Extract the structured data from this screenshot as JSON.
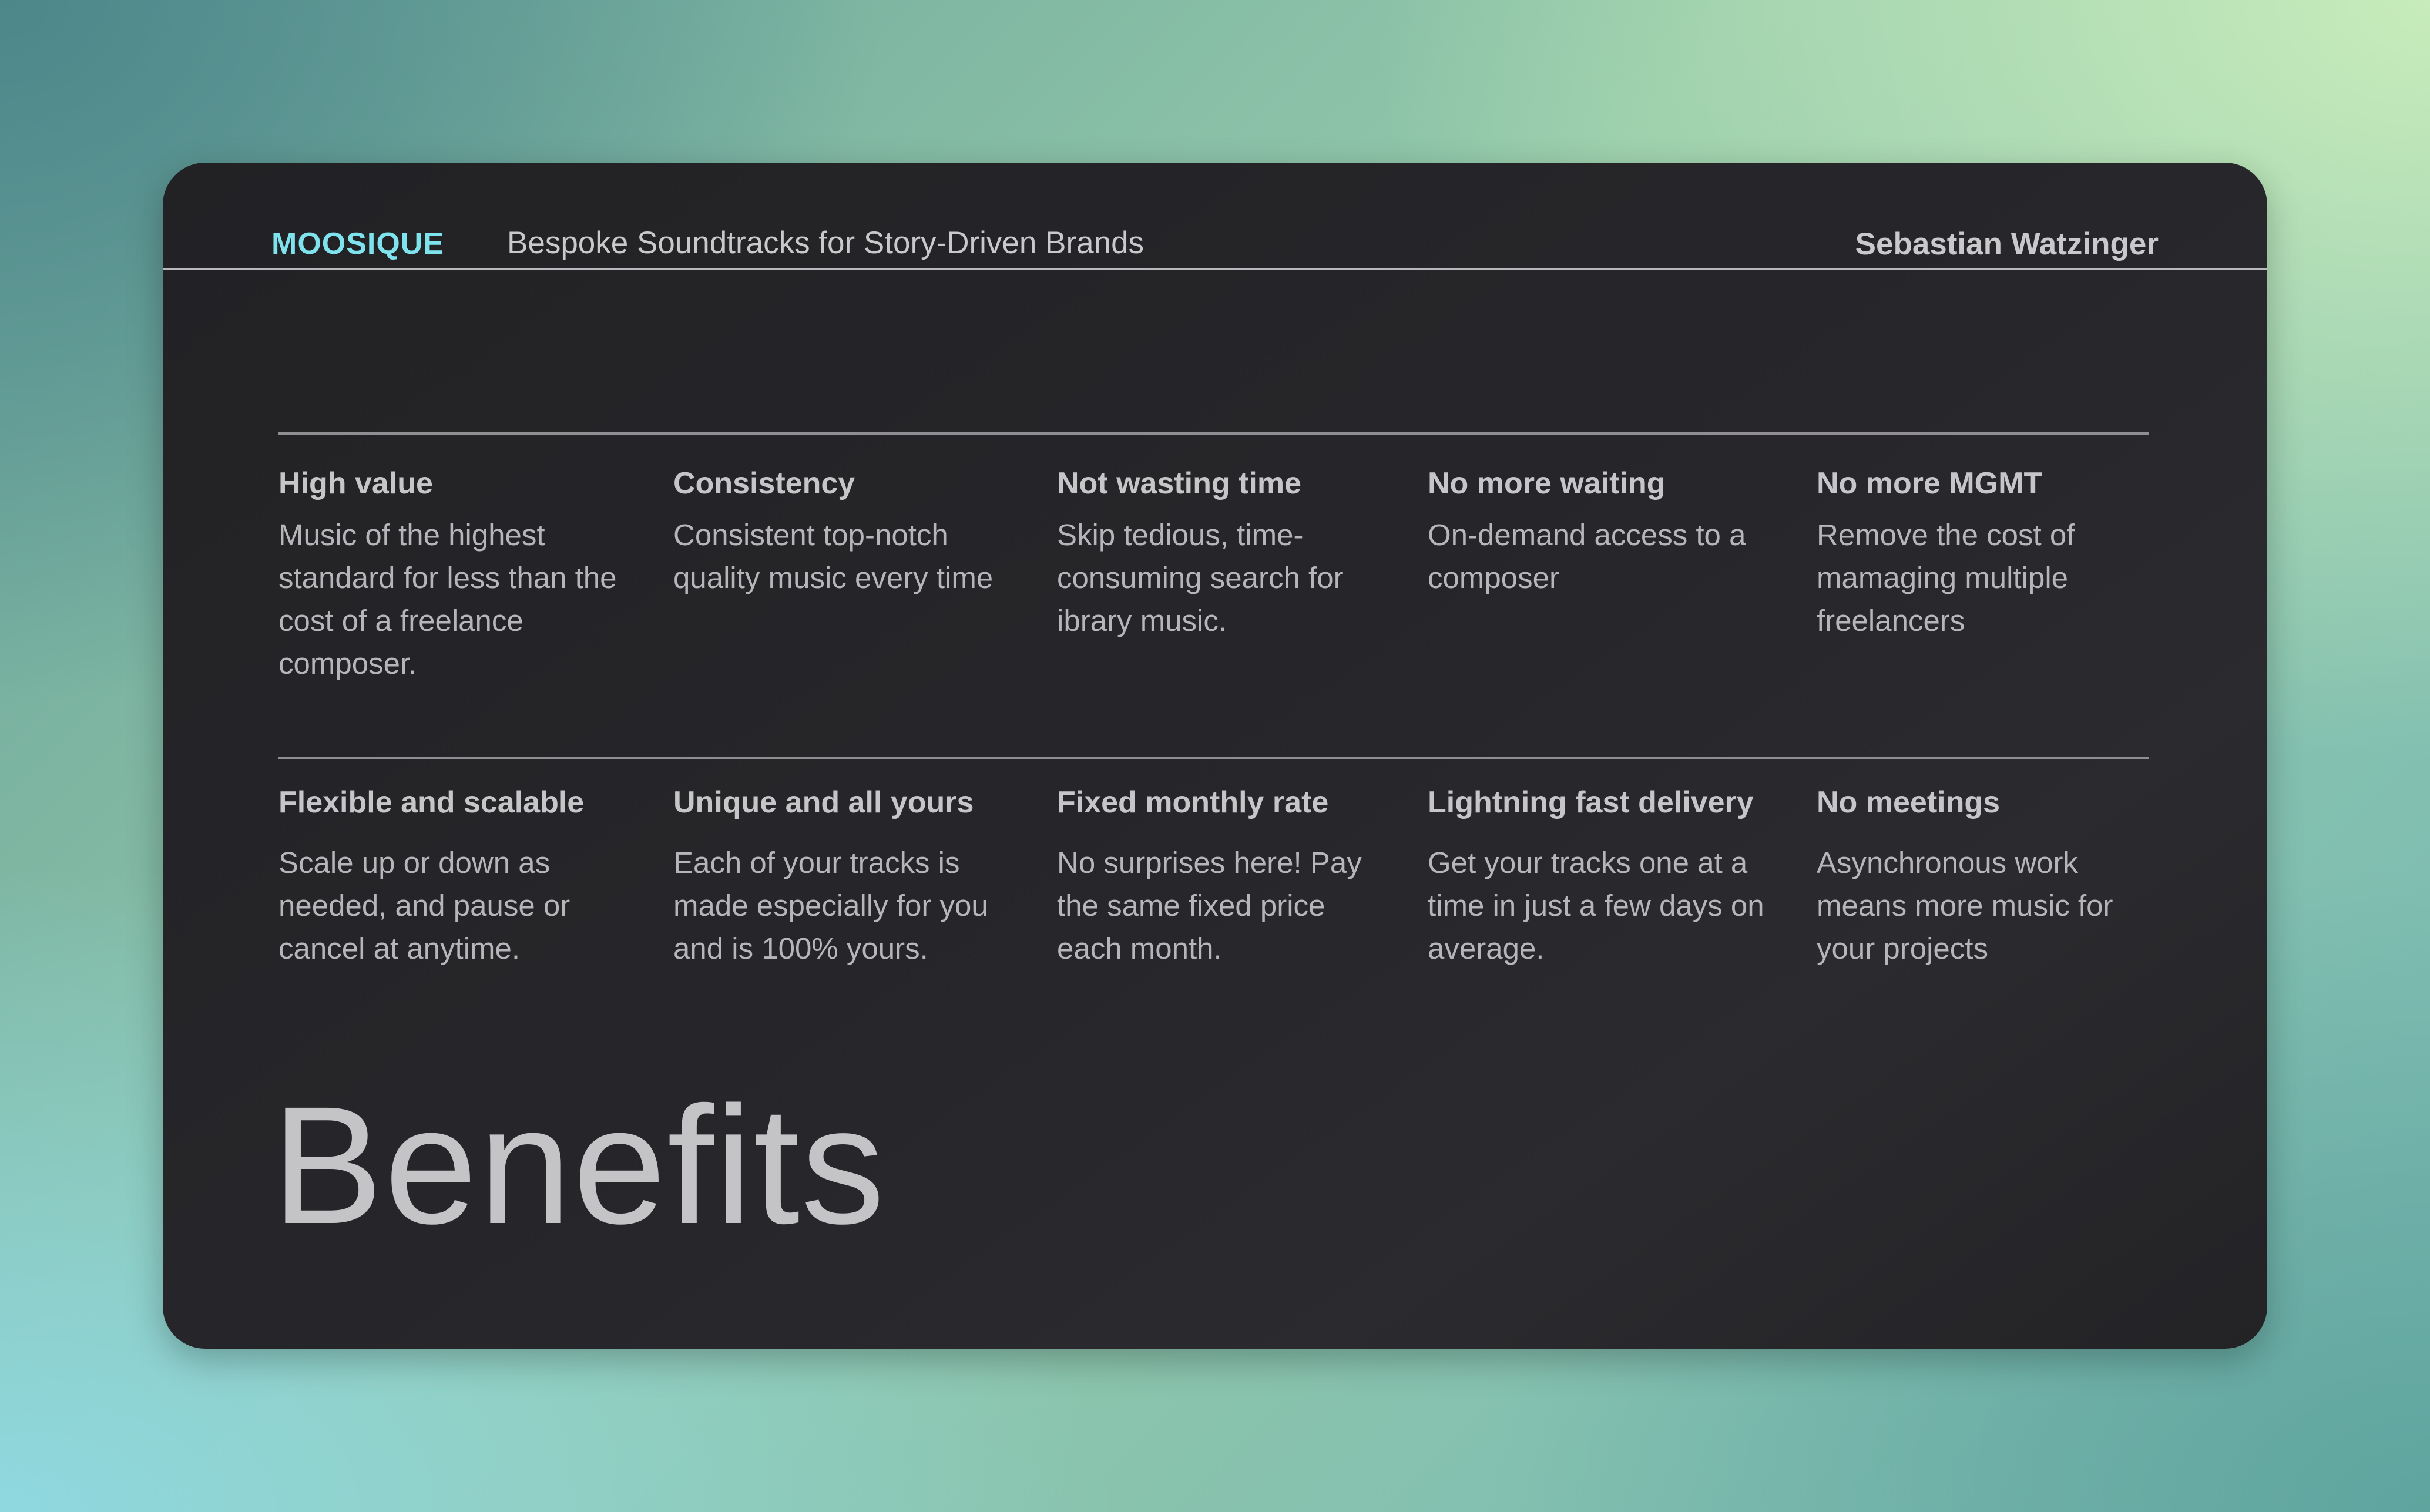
{
  "header": {
    "brand": "MOOSIQUE",
    "tagline": "Bespoke Soundtracks for Story-Driven Brands",
    "author": "Sebastian Watzinger"
  },
  "benefits": [
    {
      "title": "High value",
      "description": "Music of the highest standard for less than the cost of a freelance composer."
    },
    {
      "title": "Consistency",
      "description": "Consistent top-notch quality music every time"
    },
    {
      "title": "Not wasting time",
      "description": "Skip tedious, time-consuming search for ibrary music."
    },
    {
      "title": "No more waiting",
      "description": "On-demand access to a composer"
    },
    {
      "title": "No more MGMT",
      "description": "Remove the cost of mamaging multiple freelancers"
    },
    {
      "title": "Flexible and scalable",
      "description": "Scale up or down as needed, and pause or cancel at anytime."
    },
    {
      "title": "Unique and all yours",
      "description": "Each of your tracks is made especially for you and is 100% yours."
    },
    {
      "title": "Fixed monthly rate",
      "description": "No surprises here! Pay the same fixed price each month."
    },
    {
      "title": "Lightning fast delivery",
      "description": "Get your tracks one at a time in just a few days on average."
    },
    {
      "title": "No meetings",
      "description": "Asynchronous work means more music for your projects"
    }
  ],
  "section_heading": "Benefits",
  "colors": {
    "brand_accent": "#7fe3ee",
    "card_background": "#252528",
    "text_primary": "#c6c6c9"
  }
}
